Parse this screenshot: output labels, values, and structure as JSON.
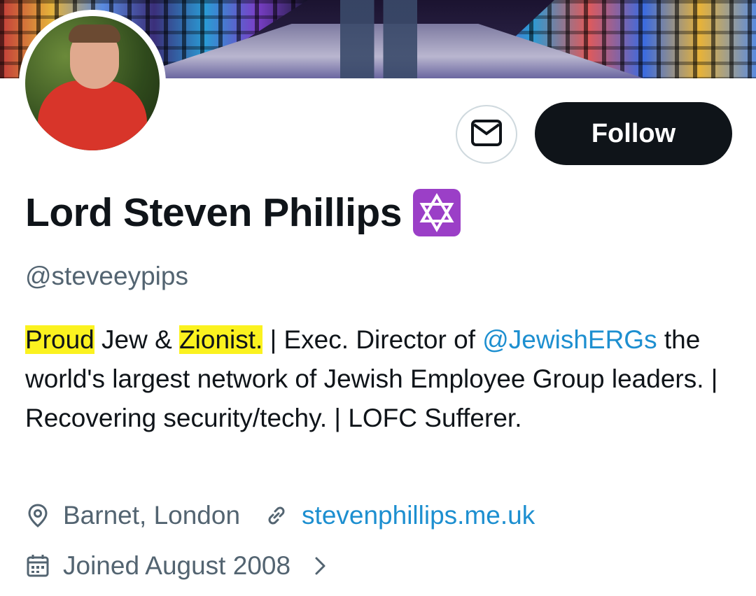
{
  "profile": {
    "name": "Lord Steven Phillips",
    "badge_emoji": "✡️",
    "handle": "@steveeypips",
    "bio": {
      "highlight1": "Proud",
      "text1": " Jew & ",
      "highlight2": "Zionist.",
      "text2": " | Exec. Director of ",
      "mention": "@JewishERGs",
      "text3": " the world's largest network of Jewish Employee Group leaders. | Recovering security/techy. | LOFC Sufferer."
    },
    "location": "Barnet, London",
    "website": "stevenphillips.me.uk",
    "joined": "Joined August 2008"
  },
  "actions": {
    "follow_label": "Follow"
  },
  "colors": {
    "follow_bg": "#0f1419",
    "link": "#1d8fd0",
    "highlight": "#fbf21f",
    "muted": "#536471"
  },
  "icons": {
    "message": "envelope-icon",
    "location": "map-pin-icon",
    "website": "link-icon",
    "joined": "calendar-icon",
    "chevron": "chevron-right-icon"
  }
}
